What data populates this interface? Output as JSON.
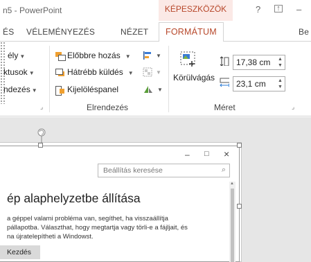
{
  "window": {
    "app_title": "n5 - PowerPoint",
    "context_group": "KÉPESZKÖZÖK",
    "help_icon": "question-icon",
    "restore_icon": "ribbon-display-icon",
    "minimize_icon": "minimize-icon"
  },
  "tabs": [
    {
      "label": "ÉS",
      "active": false
    },
    {
      "label": "VÉLEMÉNYEZÉS",
      "active": false
    },
    {
      "label": "NÉZET",
      "active": false
    },
    {
      "label": "FORMÁTUM",
      "active": true
    },
    {
      "label": "Be",
      "active": false
    }
  ],
  "ribbon": {
    "partial_items": [
      {
        "label": "ély",
        "has_dropdown": true
      },
      {
        "label": "ktusok",
        "has_dropdown": true
      },
      {
        "label": "ndezés",
        "has_dropdown": true
      }
    ],
    "arrange_group": {
      "label": "Elrendezés",
      "bring_forward": "Előbbre hozás",
      "send_backward": "Hátrébb küldés",
      "selection_pane": "Kijelöléspanel"
    },
    "size_group": {
      "label": "Méret",
      "crop_label": "Körülvágás",
      "height_value": "17,38 cm",
      "width_value": "23,1 cm"
    }
  },
  "dialog": {
    "search_placeholder": "Beállítás keresése",
    "heading": "ép alaphelyzetbe állítása",
    "description_lines": [
      "a géppel valami probléma van, segíthet, ha visszaállítja",
      "pállapotba. Választhat, hogy megtartja vagy törli-e a fájljait, és",
      "na újratelepítheti a Windowst."
    ],
    "start_button": "Kezdés",
    "minimize_glyph": "–",
    "maximize_glyph": "□",
    "close_glyph": "×"
  },
  "colors": {
    "accent": "#b7472a",
    "context_bg": "#fbe9e6",
    "canvas_bg": "#e6e6e6"
  }
}
